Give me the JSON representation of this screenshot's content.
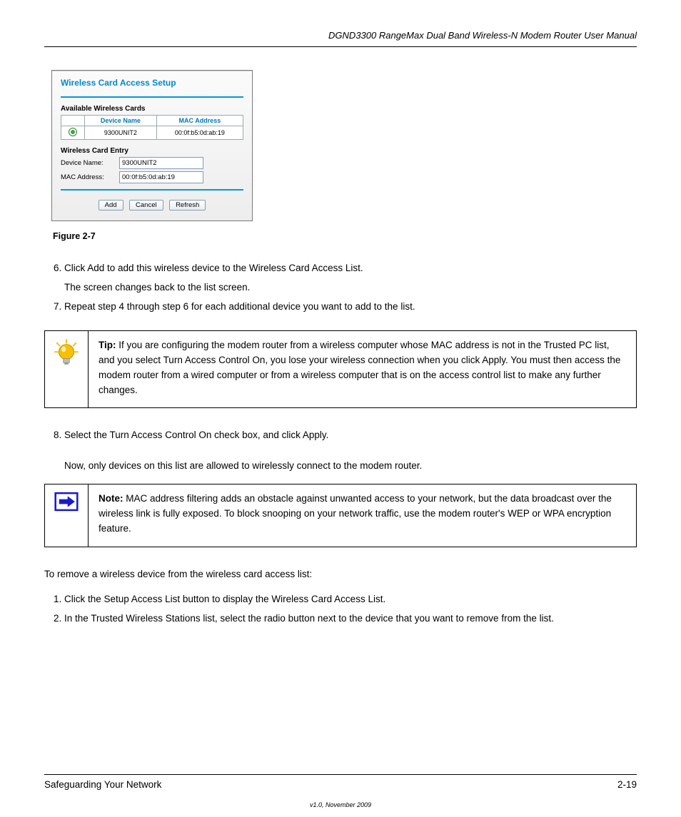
{
  "header": {
    "chapter_title": "DGND3300 RangeMax Dual Band Wireless-N Modem Router User Manual"
  },
  "dialog": {
    "title": "Wireless Card Access Setup",
    "available_label": "Available Wireless Cards",
    "table": {
      "col_device": "Device Name",
      "col_mac": "MAC Address",
      "rows": [
        {
          "device": "9300UNIT2",
          "mac": "00:0f:b5:0d:ab:19"
        }
      ]
    },
    "entry_label": "Wireless Card Entry",
    "device_name_label": "Device Name:",
    "device_name_value": "9300UNIT2",
    "mac_label": "MAC Address:",
    "mac_value": "00:0f:b5:0d:ab:19",
    "buttons": {
      "add": "Add",
      "cancel": "Cancel",
      "refresh": "Refresh"
    }
  },
  "figure_caption": "Figure 2-7",
  "steps": {
    "s6": "Click Add to add this wireless device to the Wireless Card Access List.",
    "s6_after": "The screen changes back to the list screen.",
    "s7": "Repeat step 4 through step 6 for each additional device you want to add to the list.",
    "s8": "Select the Turn Access Control On check box, and click Apply."
  },
  "tip": {
    "label": "Tip:",
    "text": " If you are configuring the modem router from a wireless computer whose MAC address is not in the Trusted PC list, and you select Turn Access Control On, you lose your wireless connection when you click Apply. You must then access the modem router from a wired computer or from a wireless computer that is on the access control list to make any further changes."
  },
  "after_tip": "Now, only devices on this list are allowed to wirelessly connect to the modem router.",
  "note": {
    "label": "Note:",
    "text": " MAC address filtering adds an obstacle against unwanted access to your network, but the data broadcast over the wireless link is fully exposed. To block snooping on your network traffic, use the modem router's WEP or WPA encryption feature."
  },
  "restore_heading": "To remove a wireless device from the wireless card access list:",
  "restore_steps": {
    "r1": "Click the Setup Access List button to display the Wireless Card Access List.",
    "r2": "In the Trusted Wireless Stations list, select the radio button next to the device that you want to remove from the list."
  },
  "footer": {
    "left": "Safeguarding Your Network",
    "right": "2-19"
  },
  "version_line": "v1.0, November 2009"
}
